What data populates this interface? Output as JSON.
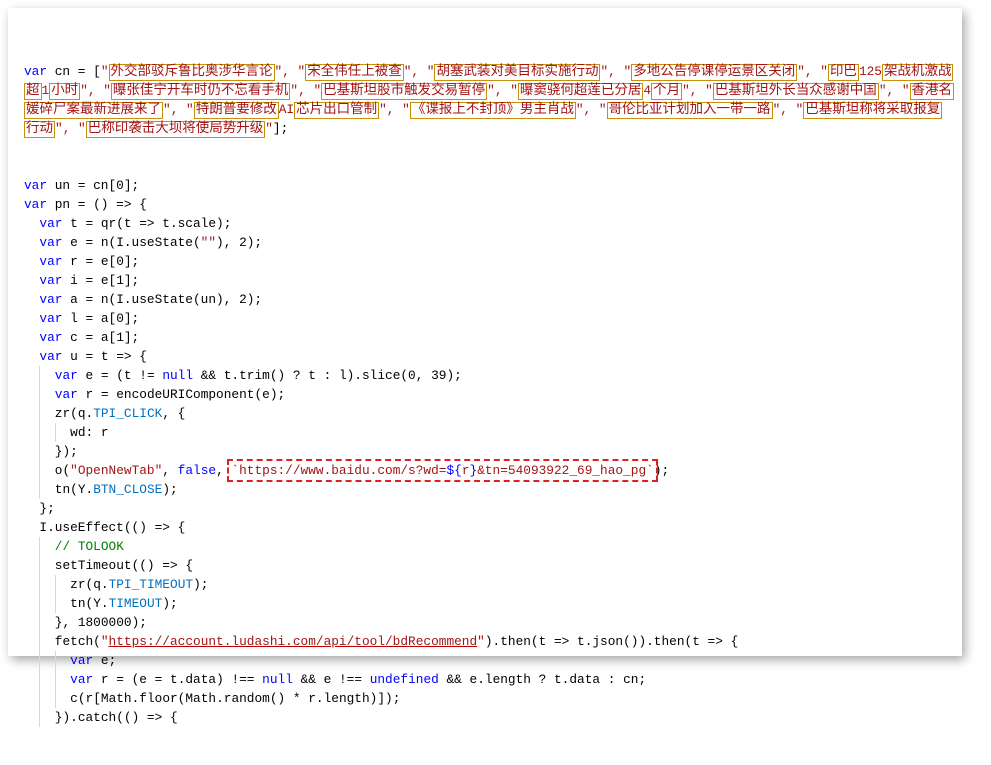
{
  "colors": {
    "keyword": "#0000ff",
    "string": "#a31515",
    "number": "#098658",
    "comment": "#008000",
    "property": "#0070c1",
    "highlight_box": "#c8900a",
    "dashed_box": "#e02020"
  },
  "first_statement": {
    "prefix": "var cn = [",
    "suffix": "];",
    "items": [
      [
        [
          "外交部驳斥鲁比奥涉华言论",
          true
        ]
      ],
      [
        [
          "宋全伟任上被查",
          true
        ]
      ],
      [
        [
          "胡塞武装对美目标实施行动",
          true
        ]
      ],
      [
        [
          "多地公告停课停运景区关闭",
          true
        ]
      ],
      [
        [
          "印巴",
          true
        ],
        [
          "125",
          false
        ],
        [
          "架战机激战",
          true
        ],
        [
          "超",
          true
        ],
        [
          "1",
          false
        ],
        [
          "小时",
          true
        ]
      ],
      [
        [
          "曝张佳宁开车时仍不忘看手机",
          true
        ]
      ],
      [
        [
          "巴基斯坦股市触发交易暂停",
          true
        ]
      ],
      [
        [
          "曝窦骁何超莲已分居",
          true
        ],
        [
          "4",
          false
        ],
        [
          "个月",
          true
        ]
      ],
      [
        [
          "巴基斯坦外长当众感谢中国",
          true
        ]
      ],
      [
        [
          "香港名",
          true
        ],
        [
          "媛碎尸案最新进展来了",
          true
        ]
      ],
      [
        [
          "特朗普要修改",
          true
        ],
        [
          "AI",
          false
        ],
        [
          "芯片出口管制",
          true
        ]
      ],
      [
        [
          "《谍报上不封顶》男主肖战",
          true
        ]
      ],
      [
        [
          "哥伦比亚计划加入一带一路",
          true
        ]
      ],
      [
        [
          "巴基斯坦称将采取报复",
          true
        ],
        [
          "行动",
          true
        ]
      ],
      [
        [
          "巴称印袭击大坝将使局势升级",
          true
        ]
      ]
    ]
  },
  "lines": [
    {
      "indent": 0,
      "text": "var un = cn[0];"
    },
    {
      "indent": 0,
      "text": "var pn = () => {"
    },
    {
      "indent": 1,
      "text": "var t = qr(t => t.scale);"
    },
    {
      "indent": 1,
      "text": "var e = n(I.useState(\"\"), 2);"
    },
    {
      "indent": 1,
      "text": "var r = e[0];"
    },
    {
      "indent": 1,
      "text": "var i = e[1];"
    },
    {
      "indent": 1,
      "text": "var a = n(I.useState(un), 2);"
    },
    {
      "indent": 1,
      "text": "var l = a[0];"
    },
    {
      "indent": 1,
      "text": "var c = a[1];"
    },
    {
      "indent": 1,
      "text": "var u = t => {"
    },
    {
      "indent": 2,
      "text": "var e = (t != null && t.trim() ? t : l).slice(0, 39);"
    },
    {
      "indent": 2,
      "text": "var r = encodeURIComponent(e);"
    },
    {
      "indent": 2,
      "text": "zr(q.TPI_CLICK, {"
    },
    {
      "indent": 3,
      "text": "wd: r"
    },
    {
      "indent": 2,
      "text": "});"
    },
    {
      "indent": 2,
      "text": "o(\"OpenNewTab\", false, `https://www.baidu.com/s?wd=${r}&tn=54093922_69_hao_pg`);",
      "mark": "dashed"
    },
    {
      "indent": 2,
      "text": "tn(Y.BTN_CLOSE);"
    },
    {
      "indent": 1,
      "text": "};"
    },
    {
      "indent": 1,
      "text": "I.useEffect(() => {"
    },
    {
      "indent": 2,
      "text": "// TOLOOK"
    },
    {
      "indent": 2,
      "text": "setTimeout(() => {"
    },
    {
      "indent": 3,
      "text": "zr(q.TPI_TIMEOUT);"
    },
    {
      "indent": 3,
      "text": "tn(Y.TIMEOUT);"
    },
    {
      "indent": 2,
      "text": "}, 1800000);"
    },
    {
      "indent": 2,
      "text": "fetch(\"https://account.ludashi.com/api/tool/bdRecommend\").then(t => t.json()).then(t => {",
      "mark": "underline"
    },
    {
      "indent": 3,
      "text": "var e;"
    },
    {
      "indent": 3,
      "text": "var r = (e = t.data) !== null && e !== undefined && e.length ? t.data : cn;"
    },
    {
      "indent": 3,
      "text": "c(r[Math.floor(Math.random() * r.length)]);"
    },
    {
      "indent": 2,
      "text": "}).catch(() => {"
    }
  ]
}
